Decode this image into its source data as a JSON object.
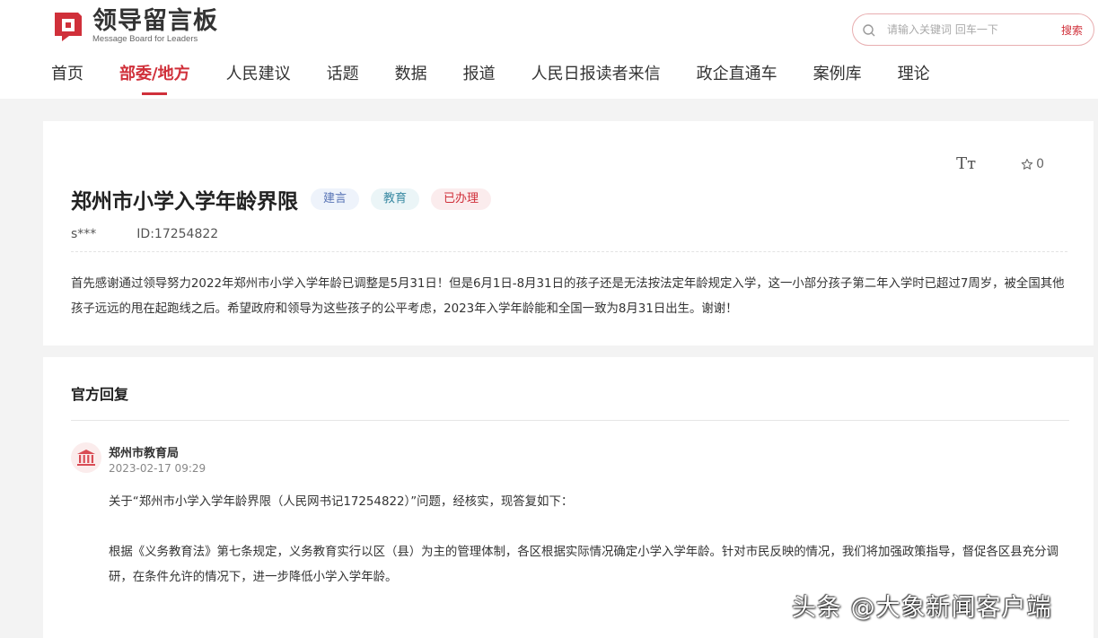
{
  "brand": {
    "name_cn": "领导留言板",
    "name_en": "Message Board for Leaders",
    "accent_color": "#d0303a"
  },
  "search": {
    "placeholder": "请输入关键词 回车一下",
    "button_label": "搜索"
  },
  "nav": {
    "items": [
      {
        "label": "首页"
      },
      {
        "label": "部委/地方",
        "active": true
      },
      {
        "label": "人民建议"
      },
      {
        "label": "话题"
      },
      {
        "label": "数据"
      },
      {
        "label": "报道"
      },
      {
        "label": "人民日报读者来信"
      },
      {
        "label": "政企直通车"
      },
      {
        "label": "案例库"
      },
      {
        "label": "理论"
      }
    ]
  },
  "message": {
    "font_tool_label": "Tт",
    "fav_count": "0",
    "title": "郑州市小学入学年龄界限",
    "tags": [
      "建言",
      "教育",
      "已办理"
    ],
    "user": "s***",
    "id_text": "ID:17254822",
    "content": "首先感谢通过领导努力2022年郑州市小学入学年龄已调整是5月31日！但是6月1日-8月31日的孩子还是无法按法定年龄规定入学，这一小部分孩子第二年入学时已超过7周岁，被全国其他孩子远远的甩在起跑线之后。希望政府和领导为这些孩子的公平考虑，2023年入学年龄能和全国一致为8月31日出生。谢谢！"
  },
  "reply": {
    "heading": "官方回复",
    "department": "郑州市教育局",
    "time": "2023-02-17 09:29",
    "paragraph1": "关于“郑州市小学入学年龄界限（人民网书记17254822）”问题，经核实，现答复如下：",
    "paragraph2": "根据《义务教育法》第七条规定，义务教育实行以区（县）为主的管理体制，各区根据实际情况确定小学入学年龄。针对市民反映的情况，我们将加强政策指导，督促各区县充分调研，在条件允许的情况下，进一步降低小学入学年龄。"
  },
  "watermark": "头条 @大象新闻客户端"
}
